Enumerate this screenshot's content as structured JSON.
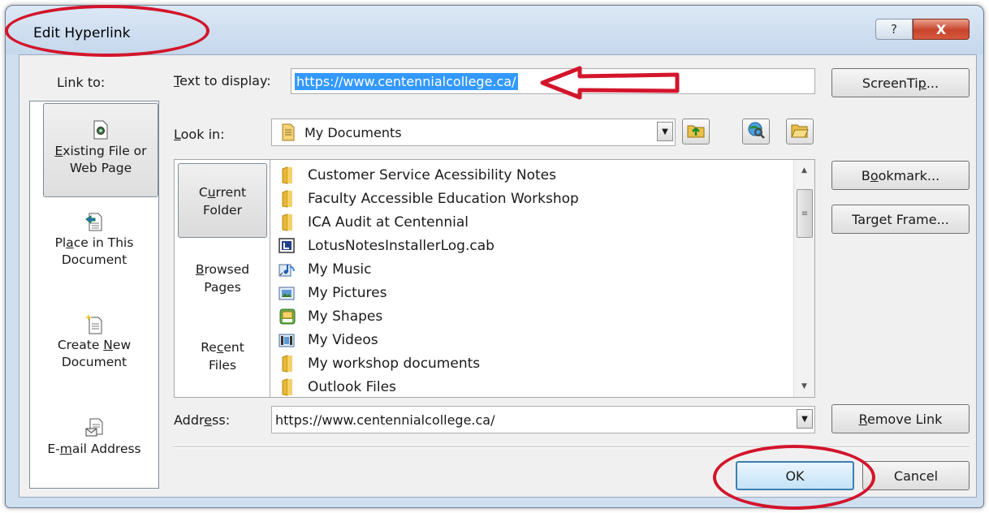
{
  "window": {
    "title": "Edit Hyperlink",
    "help_label": "?",
    "close_label": "X"
  },
  "link_to": {
    "label": "Link to:",
    "items": [
      {
        "line1_pre": "",
        "line1_u": "E",
        "line1_post": "xisting File or",
        "line2": "Web Page",
        "icon": "existing-file-icon"
      },
      {
        "line1_pre": "Pl",
        "line1_u": "a",
        "line1_post": "ce in This",
        "line2": "Document",
        "icon": "place-in-document-icon"
      },
      {
        "line1_pre": "Create ",
        "line1_u": "N",
        "line1_post": "ew",
        "line2": "Document",
        "icon": "new-document-icon"
      },
      {
        "line1_pre": "E-",
        "line1_u": "m",
        "line1_post": "ail Address",
        "line2": "",
        "icon": "email-icon"
      }
    ]
  },
  "text_to_display": {
    "label_u": "T",
    "label_rest": "ext to display:",
    "value": "https://www.centennialcollege.ca/"
  },
  "screentip_button": {
    "pre": "ScreenTi",
    "u": "p",
    "post": "..."
  },
  "look_in": {
    "label_u": "L",
    "label_rest": "ook in:",
    "value": "My Documents",
    "up_icon": "up-folder-icon",
    "web_icon": "browse-web-icon",
    "folder_icon": "browse-file-icon"
  },
  "side_tabs": [
    {
      "line1_pre": "C",
      "line1_u": "u",
      "line1_post": "rrent",
      "line2": "Folder"
    },
    {
      "line1_pre": "",
      "line1_u": "B",
      "line1_post": "rowsed",
      "line2": "Pages"
    },
    {
      "line1_pre": "Re",
      "line1_u": "c",
      "line1_post": "ent",
      "line2": "Files"
    }
  ],
  "files": [
    {
      "name": "Customer Service Acessibility Notes",
      "icon": "folder-icon"
    },
    {
      "name": "Faculty Accessible Education Workshop",
      "icon": "folder-icon"
    },
    {
      "name": "ICA Audit at Centennial",
      "icon": "folder-icon"
    },
    {
      "name": "LotusNotesInstallerLog.cab",
      "icon": "cab-file-icon"
    },
    {
      "name": "My Music",
      "icon": "music-shortcut-icon"
    },
    {
      "name": "My Pictures",
      "icon": "pictures-shortcut-icon"
    },
    {
      "name": "My Shapes",
      "icon": "shapes-folder-icon"
    },
    {
      "name": "My Videos",
      "icon": "videos-shortcut-icon"
    },
    {
      "name": "My workshop documents",
      "icon": "folder-icon"
    },
    {
      "name": "Outlook Files",
      "icon": "folder-icon"
    }
  ],
  "bookmark_button": {
    "pre": "B",
    "u": "o",
    "post": "okmark..."
  },
  "target_frame_button": {
    "pre": "Tar",
    "u": "g",
    "post": "et Frame..."
  },
  "address": {
    "label_pre": "Addr",
    "label_u": "e",
    "label_post": "ss:",
    "value": "https://www.centennialcollege.ca/"
  },
  "remove_link_button": {
    "pre": "",
    "u": "R",
    "post": "emove Link"
  },
  "ok_button": {
    "label": "OK"
  },
  "cancel_button": {
    "label": "Cancel"
  },
  "colors": {
    "annotation_red": "#d3152b",
    "selection_blue": "#3399ff",
    "title_bar": "#cfdff0"
  }
}
